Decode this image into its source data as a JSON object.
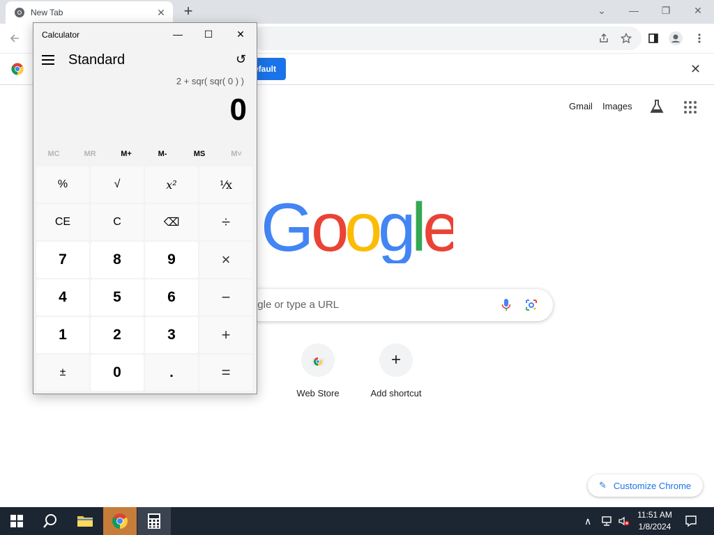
{
  "browser": {
    "tab_title": "New Tab",
    "tab_close": "✕",
    "new_tab": "+",
    "window_controls": {
      "tabsearch": "⌄",
      "minimize": "—",
      "restore": "❐",
      "close": "✕"
    }
  },
  "infobar": {
    "button_label": "efault",
    "close": "✕"
  },
  "ntp": {
    "gmail": "Gmail",
    "images": "Images",
    "search_placeholder": "gle or type a URL",
    "shortcuts": [
      {
        "label": "Web Store",
        "icon": "chrome-webstore-icon"
      },
      {
        "label": "Add shortcut",
        "icon": "plus-icon",
        "glyph": "+"
      }
    ],
    "customize_label": "Customize Chrome",
    "customize_icon": "✎"
  },
  "calculator": {
    "title": "Calculator",
    "controls": {
      "minimize": "—",
      "maximize": "☐",
      "close": "✕"
    },
    "mode": "Standard",
    "history_icon": "↺",
    "expression": "2 + sqr( sqr( 0 ) )",
    "display": "0",
    "memory": [
      {
        "label": "MC",
        "enabled": false
      },
      {
        "label": "MR",
        "enabled": false
      },
      {
        "label": "M+",
        "enabled": true
      },
      {
        "label": "M-",
        "enabled": true
      },
      {
        "label": "MS",
        "enabled": true
      },
      {
        "label": "M˅",
        "enabled": false
      }
    ],
    "keys": {
      "percent": "%",
      "sqrt": "√",
      "square": "x²",
      "reciprocal": "¹⁄x",
      "ce": "CE",
      "c": "C",
      "backspace": "⌫",
      "divide": "÷",
      "seven": "7",
      "eight": "8",
      "nine": "9",
      "multiply": "×",
      "four": "4",
      "five": "5",
      "six": "6",
      "subtract": "−",
      "one": "1",
      "two": "2",
      "three": "3",
      "add": "+",
      "negate": "±",
      "zero": "0",
      "decimal": ".",
      "equals": "="
    }
  },
  "taskbar": {
    "clock_time": "11:51 AM",
    "clock_date": "1/8/2024",
    "tray_chevron": "∧"
  },
  "colors": {
    "google_blue": "#4285F4",
    "google_red": "#EA4335",
    "google_yellow": "#FBBC05",
    "google_green": "#34A853",
    "accent": "#1a73e8",
    "taskbar": "#1c2532"
  }
}
